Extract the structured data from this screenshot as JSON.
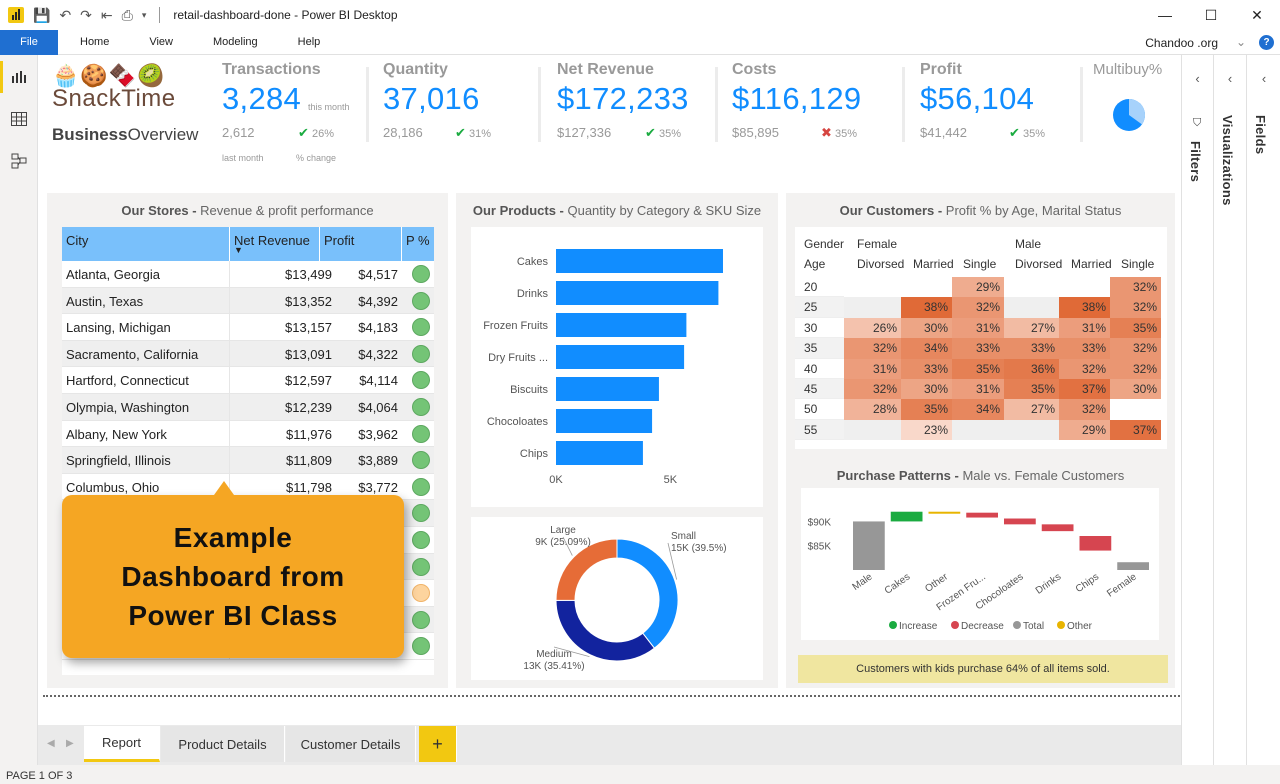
{
  "window": {
    "title": "retail-dashboard-done - Power BI Desktop",
    "controls": {
      "minimize": "—",
      "maximize": "☐",
      "close": "✕"
    }
  },
  "ribbon": {
    "file": "File",
    "tabs": [
      "Home",
      "View",
      "Modeling",
      "Help"
    ],
    "account": "Chandoo .org",
    "help": "?"
  },
  "panes": {
    "filters": "Filters",
    "visualizations": "Visualizations",
    "fields": "Fields"
  },
  "brand": {
    "treats": "🧁🍪🍫🥝",
    "name": "SnackTime",
    "subtitle_bold": "Business",
    "subtitle": "Overview"
  },
  "kpis": [
    {
      "label": "Transactions",
      "value": "3,284",
      "prev": "2,612",
      "change": "26%",
      "status": "ok",
      "note_value": "this month",
      "note_prev": "last month",
      "note_change": "% change"
    },
    {
      "label": "Quantity",
      "value": "37,016",
      "prev": "28,186",
      "change": "31%",
      "status": "ok"
    },
    {
      "label": "Net Revenue",
      "value": "$172,233",
      "prev": "$127,336",
      "change": "35%",
      "status": "ok"
    },
    {
      "label": "Costs",
      "value": "$116,129",
      "prev": "$85,895",
      "change": "35%",
      "status": "bad"
    },
    {
      "label": "Profit",
      "value": "$56,104",
      "prev": "$41,442",
      "change": "35%",
      "status": "ok"
    }
  ],
  "multibuy": {
    "label": "Multibuy%",
    "fraction": 0.35
  },
  "stores": {
    "title_bold": "Our Stores -",
    "title": " Revenue & profit performance",
    "columns": [
      "City",
      "Net Revenue",
      "Profit",
      "P %"
    ],
    "rows": [
      {
        "city": "Atlanta, Georgia",
        "revenue": "$13,499",
        "profit": "$4,517",
        "status": "green"
      },
      {
        "city": "Austin, Texas",
        "revenue": "$13,352",
        "profit": "$4,392",
        "status": "green"
      },
      {
        "city": "Lansing, Michigan",
        "revenue": "$13,157",
        "profit": "$4,183",
        "status": "green"
      },
      {
        "city": "Sacramento, California",
        "revenue": "$13,091",
        "profit": "$4,322",
        "status": "green"
      },
      {
        "city": "Hartford, Connecticut",
        "revenue": "$12,597",
        "profit": "$4,114",
        "status": "green"
      },
      {
        "city": "Olympia, Washington",
        "revenue": "$12,239",
        "profit": "$4,064",
        "status": "green"
      },
      {
        "city": "Albany, New York",
        "revenue": "$11,976",
        "profit": "$3,962",
        "status": "green"
      },
      {
        "city": "Springfield, Illinois",
        "revenue": "$11,809",
        "profit": "$3,889",
        "status": "green"
      },
      {
        "city": "Columbus, Ohio",
        "revenue": "$11,798",
        "profit": "$3,772",
        "status": "green"
      },
      {
        "city": "",
        "revenue": "",
        "profit": "",
        "status": "green"
      },
      {
        "city": "",
        "revenue": "",
        "profit": "",
        "status": "green"
      },
      {
        "city": "",
        "revenue": "",
        "profit": "",
        "status": "green"
      },
      {
        "city": "",
        "revenue": "",
        "profit": "",
        "status": "amber"
      },
      {
        "city": "",
        "revenue": "",
        "profit": "",
        "status": "green"
      },
      {
        "city": "",
        "revenue": "",
        "profit": "",
        "status": "green"
      }
    ]
  },
  "callout": {
    "line1": "Example",
    "line2": "Dashboard from",
    "line3": "Power BI Class"
  },
  "products": {
    "title_bold": "Our Products -",
    "title": " Quantity by Category & SKU Size"
  },
  "customers": {
    "title_bold": "Our Customers -",
    "title": " Profit % by Age, Marital Status",
    "hdr_gender": "Gender",
    "hdr_age": "Age",
    "female": "Female",
    "male": "Male",
    "statuses": [
      "Divorsed",
      "Married",
      "Single",
      "Divorsed",
      "Married",
      "Single"
    ]
  },
  "patterns": {
    "title_bold": "Purchase Patterns -",
    "title": " Male vs. Female Customers",
    "note": "Customers with kids purchase 64% of all items sold."
  },
  "tabs": [
    "Report",
    "Product Details",
    "Customer Details"
  ],
  "add_tab": "+",
  "status_bar": "PAGE 1 OF 3",
  "colors": {
    "accent": "#118dff",
    "brand_yellow": "#f2c811",
    "heat_low": "#f7d0bf",
    "heat_high": "#e06a37"
  },
  "chart_data": [
    {
      "type": "bar",
      "orientation": "horizontal",
      "categories": [
        "Cakes",
        "Drinks",
        "Frozen Fruits",
        "Dry Fruits ...",
        "Biscuits",
        "Chocoloates",
        "Chips"
      ],
      "values": [
        7300,
        7100,
        5700,
        5600,
        4500,
        4200,
        3800
      ],
      "xticks": [
        "0K",
        "5K"
      ],
      "xlim": [
        0,
        8000
      ],
      "color": "#118dff"
    },
    {
      "type": "pie",
      "donut": true,
      "slices": [
        {
          "label": "Small",
          "value_label": "15K (39.5%)",
          "share": 39.5,
          "color": "#118dff"
        },
        {
          "label": "Medium",
          "value_label": "13K (35.41%)",
          "share": 35.41,
          "color": "#12239e"
        },
        {
          "label": "Large",
          "value_label": "9K (25.09%)",
          "share": 25.09,
          "color": "#e66c37"
        }
      ]
    },
    {
      "type": "heatmap",
      "ages": [
        "20",
        "25",
        "30",
        "35",
        "40",
        "45",
        "50",
        "55"
      ],
      "columns": [
        "Female Divorsed",
        "Female Married",
        "Female Single",
        "Male Divorsed",
        "Male Married",
        "Male Single"
      ],
      "values": [
        [
          null,
          null,
          29,
          null,
          null,
          32
        ],
        [
          null,
          38,
          32,
          null,
          38,
          32
        ],
        [
          26,
          30,
          31,
          27,
          31,
          35
        ],
        [
          32,
          34,
          33,
          33,
          33,
          32
        ],
        [
          31,
          33,
          35,
          36,
          32,
          32
        ],
        [
          32,
          30,
          31,
          35,
          37,
          30
        ],
        [
          28,
          35,
          34,
          27,
          32,
          null
        ],
        [
          null,
          23,
          null,
          null,
          29,
          37
        ]
      ],
      "unit": "%"
    },
    {
      "type": "bar",
      "subtype": "waterfall",
      "categories": [
        "Male",
        "Cakes",
        "Other",
        "Frozen Fru...",
        "Chocoloates",
        "Drinks",
        "Chips",
        "Female"
      ],
      "yticks": [
        "$90K",
        "$85K"
      ],
      "steps": [
        {
          "kind": "total",
          "start": 80000,
          "end": 90000
        },
        {
          "kind": "increase",
          "start": 90000,
          "end": 92000
        },
        {
          "kind": "other",
          "start": 92000,
          "end": 91900
        },
        {
          "kind": "decrease",
          "start": 91800,
          "end": 90800
        },
        {
          "kind": "decrease",
          "start": 90600,
          "end": 89400
        },
        {
          "kind": "decrease",
          "start": 89400,
          "end": 88000
        },
        {
          "kind": "decrease",
          "start": 87000,
          "end": 84000
        },
        {
          "kind": "total",
          "start": 80000,
          "end": 81600
        }
      ],
      "ylim": [
        80000,
        94000
      ],
      "legend": [
        "Increase",
        "Decrease",
        "Total",
        "Other"
      ],
      "legend_colors": [
        "#1aab40",
        "#d64550",
        "#979797",
        "#e8b400"
      ]
    }
  ]
}
